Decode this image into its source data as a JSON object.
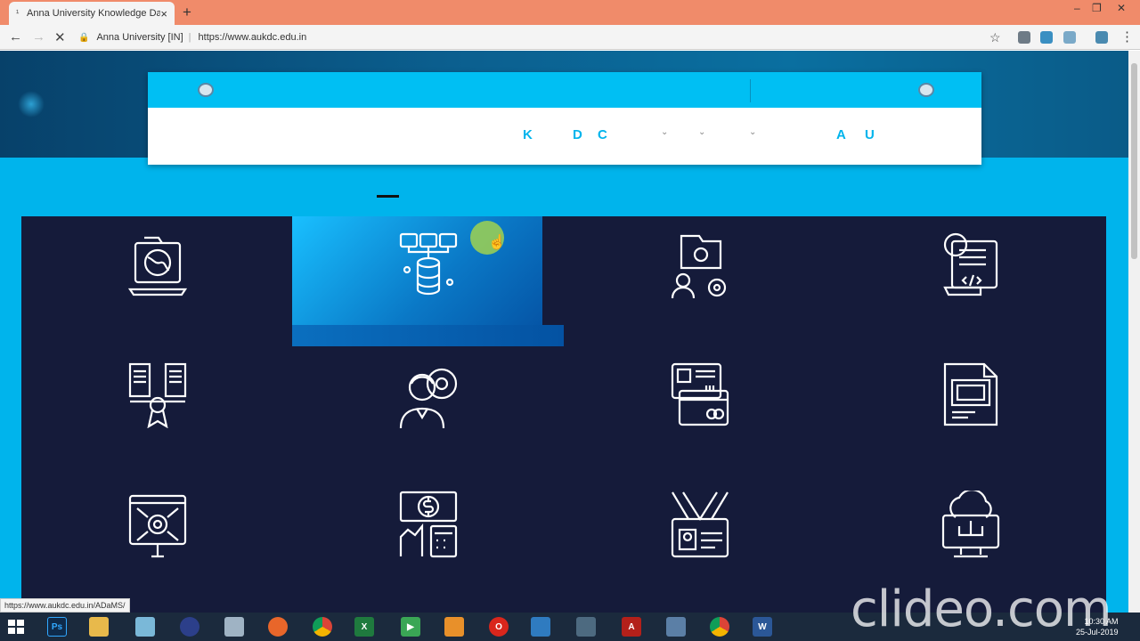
{
  "browser": {
    "tab_title": "Anna University Knowledge Data",
    "tab_favicon": "¹",
    "tab_close": "×",
    "new_tab": "+",
    "site_label": "Anna University [IN]",
    "url": "https://www.aukdc.edu.in",
    "status_url": "https://www.aukdc.edu.in/ADaMS/"
  },
  "nav": {
    "letters": [
      "K",
      "D",
      "C",
      "A",
      "U"
    ]
  },
  "grid_icons": [
    "laptop-globe-icon",
    "database-network-icon",
    "folder-email-settings-icon",
    "code-document-icon",
    "documents-certificate-icon",
    "person-gear-icon",
    "id-card-icon",
    "document-screen-icon",
    "screen-gear-icon",
    "finance-calculator-icon",
    "id-badge-icon",
    "cloud-computer-icon"
  ],
  "taskbar": {
    "clock_time": "10:30 AM",
    "clock_date": "25-Jul-2019",
    "apps": [
      "windows-start-icon",
      "photoshop-icon",
      "file-explorer-icon",
      "notepad-icon",
      "media-icon",
      "calculator-icon",
      "firefox-icon",
      "chrome-icon",
      "excel-icon",
      "video-icon",
      "package-icon",
      "opera-icon",
      "network-icon",
      "desktop-icon",
      "acrobat-icon",
      "tools-icon",
      "chrome-icon",
      "word-icon"
    ]
  },
  "watermark": "clideo.com"
}
